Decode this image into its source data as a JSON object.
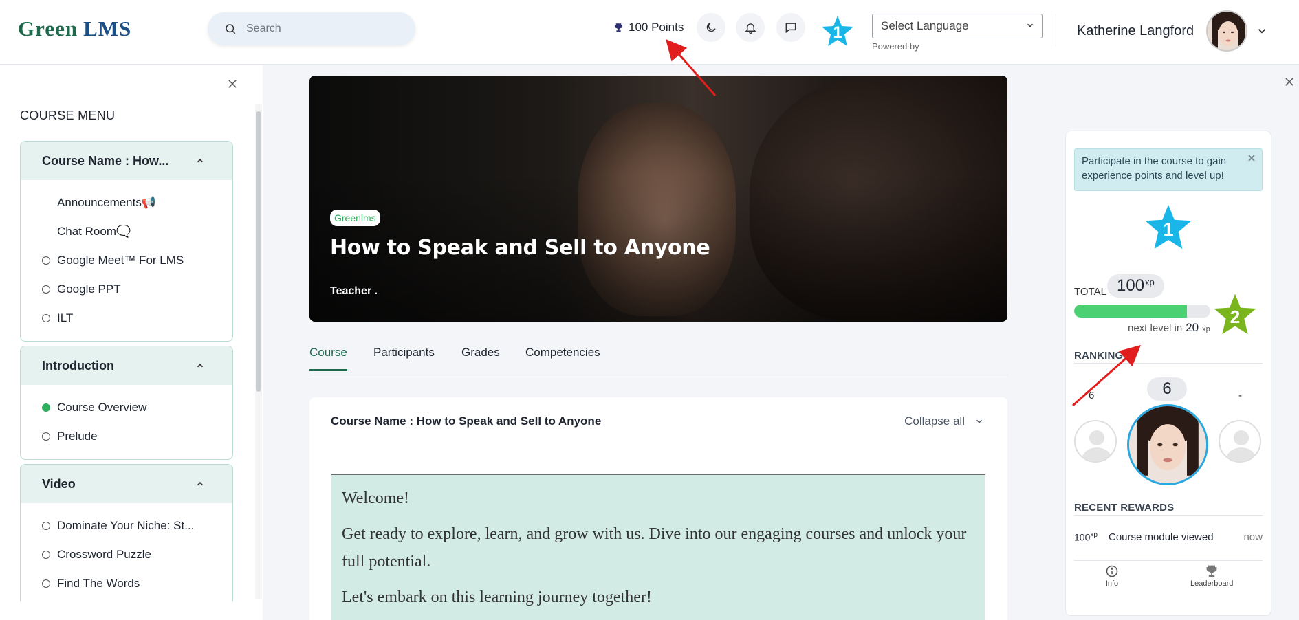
{
  "header": {
    "logo_green": "Green",
    "logo_lms": "LMS",
    "search_placeholder": "Search",
    "points_label": "100 Points",
    "level": "1",
    "language_select": "Select Language",
    "powered_by": "Powered by",
    "user_name": "Katherine Langford"
  },
  "sidebar": {
    "title": "COURSE MENU",
    "sections": [
      {
        "title": "Course Name : How...",
        "items": [
          {
            "label": "Announcements📢",
            "status": "none"
          },
          {
            "label": "Chat Room🗨️",
            "status": "none"
          },
          {
            "label": "Google Meet™ For LMS",
            "status": "empty"
          },
          {
            "label": "Google PPT",
            "status": "empty"
          },
          {
            "label": "ILT",
            "status": "empty"
          }
        ]
      },
      {
        "title": "Introduction",
        "items": [
          {
            "label": "Course Overview",
            "status": "done"
          },
          {
            "label": "Prelude",
            "status": "empty"
          }
        ]
      },
      {
        "title": "Video",
        "items": [
          {
            "label": "Dominate Your Niche: St...",
            "status": "empty"
          },
          {
            "label": "Crossword Puzzle",
            "status": "empty"
          },
          {
            "label": "Find The Words",
            "status": "empty"
          }
        ]
      }
    ]
  },
  "course": {
    "badge": "Greenlms",
    "title": "How to Speak and Sell to Anyone",
    "teacher": "Teacher .",
    "tabs": [
      "Course",
      "Participants",
      "Grades",
      "Competencies"
    ],
    "active_tab": "Course",
    "card_title": "Course Name : How to Speak and Sell to Anyone",
    "collapse_label": "Collapse all",
    "welcome": [
      "Welcome!",
      "Get ready to explore, learn, and grow with us. Dive into our engaging courses and unlock your full potential.",
      "Let's embark on this learning journey together!"
    ]
  },
  "xp_panel": {
    "info_text": "Participate in the course to gain experience points and level up!",
    "current_level": "1",
    "next_level": "2",
    "total_label": "TOTAL",
    "total_xp": "100",
    "xp_unit": "xp",
    "progress_fraction": 0.83,
    "next_level_label": "next level in",
    "next_level_xp": "20",
    "ranking_label": "RANKING",
    "rank_left": "6",
    "rank_self": "6",
    "rank_right": "-",
    "recent_rewards_label": "RECENT REWARDS",
    "reward_xp": "100",
    "reward_desc": "Course module viewed",
    "reward_time": "now",
    "footer_info": "Info",
    "footer_leaderboard": "Leaderboard"
  },
  "colors": {
    "brand_green": "#1d6b4c",
    "level_blue": "#1ab6e8",
    "level_green": "#7ab51d",
    "progress_green": "#4cd074",
    "annotation_red": "#e11d1d"
  }
}
